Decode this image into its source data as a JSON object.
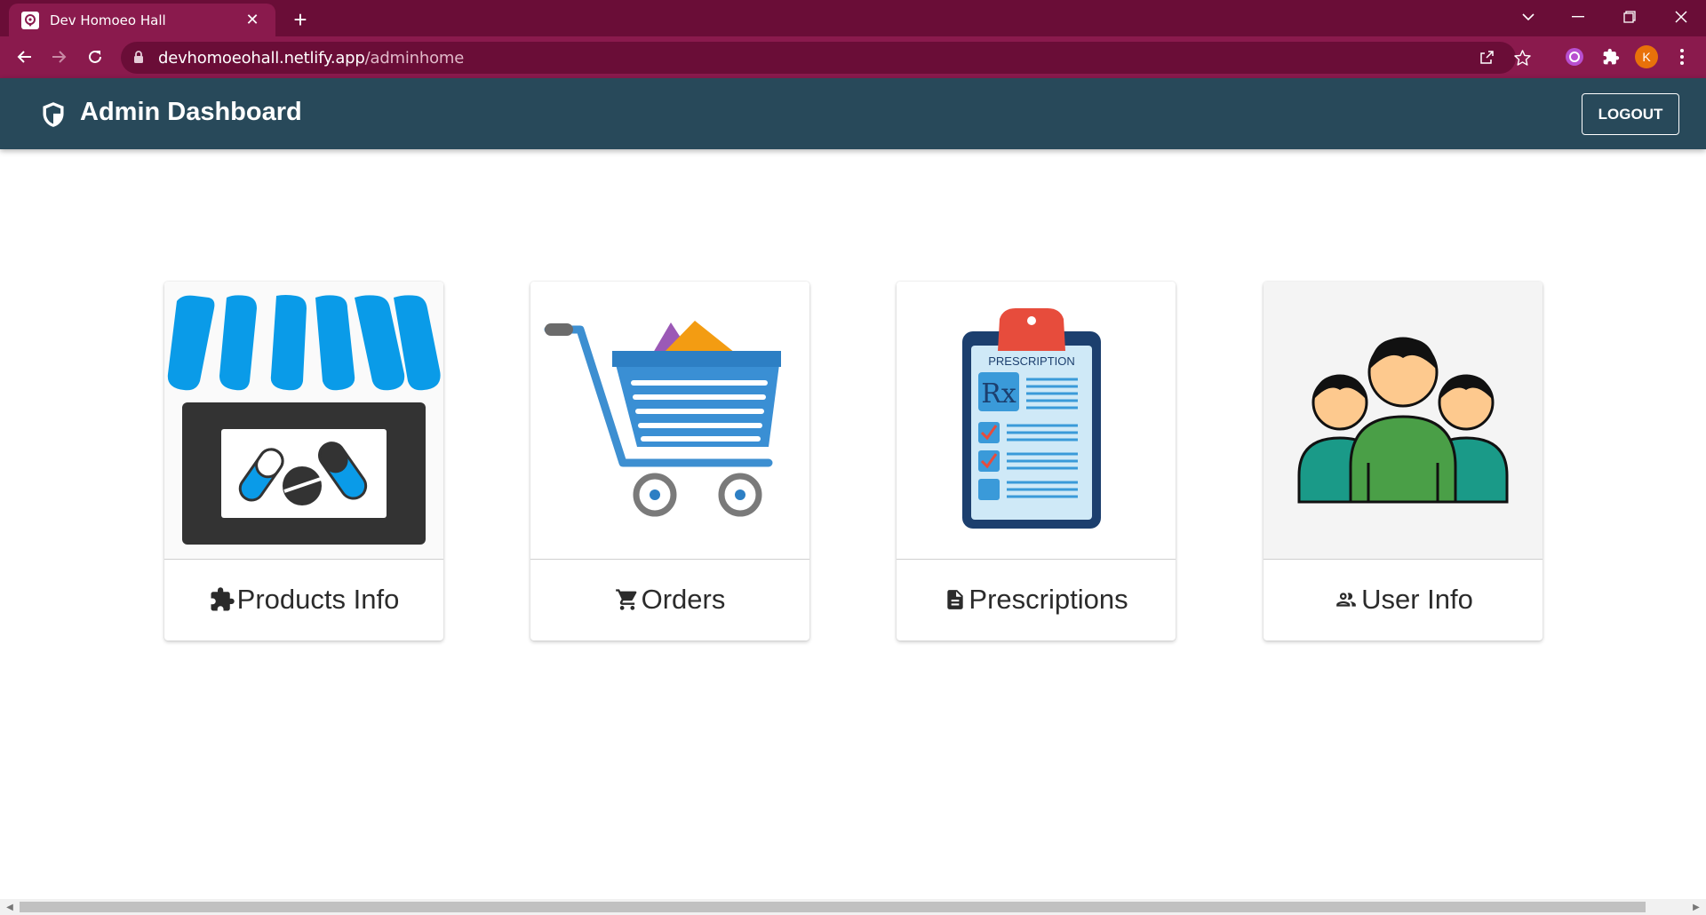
{
  "browser": {
    "tab_title": "Dev Homoeo Hall",
    "url_host": "devhomoeohall.netlify.app",
    "url_path": "/adminhome",
    "profile_initial": "K"
  },
  "app": {
    "title": "Admin Dashboard",
    "logout_label": "LOGOUT"
  },
  "cards": [
    {
      "label": "Products Info",
      "icon": "puzzle-icon",
      "image": "pharmacy-store-illustration"
    },
    {
      "label": "Orders",
      "icon": "cart-icon",
      "image": "shopping-cart-illustration"
    },
    {
      "label": "Prescriptions",
      "icon": "document-icon",
      "image": "prescription-clipboard-illustration"
    },
    {
      "label": "User Info",
      "icon": "users-icon",
      "image": "user-group-illustration"
    }
  ],
  "images": {
    "prescription_text": "PRESCRIPTION",
    "rx_text": "Rx"
  },
  "colors": {
    "tabbar": "#6a0d37",
    "toolbar": "#8a1a4d",
    "header": "#28495a",
    "profile": "#e8710a"
  }
}
